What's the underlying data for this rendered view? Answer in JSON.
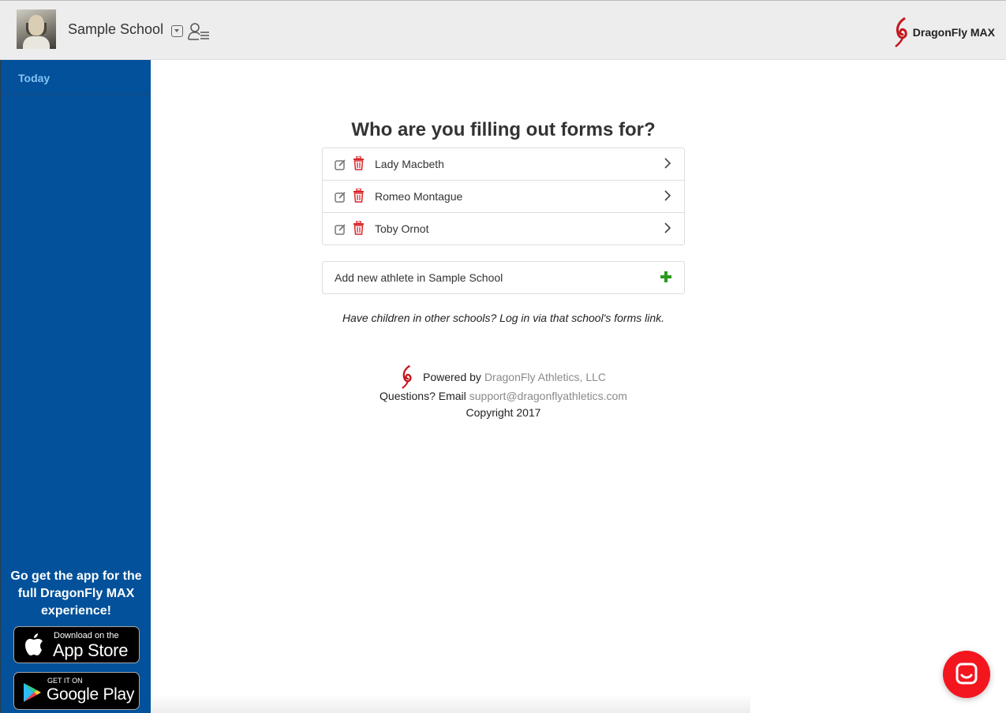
{
  "header": {
    "school_name": "Sample School",
    "brand_name": "DragonFly MAX",
    "brand_color": "#c4161c",
    "background": "#ededed"
  },
  "sidebar": {
    "background": "#02519a",
    "items": [
      {
        "label": "Today",
        "color": "#85c3f4"
      }
    ],
    "promo_text": "Go get the app for the full DragonFly MAX experience!",
    "app_store": {
      "small": "Download on the",
      "big": "App Store"
    },
    "google_play": {
      "small": "GET IT ON",
      "big": "Google Play"
    }
  },
  "main": {
    "title": "Who are you filling out forms for?",
    "athletes": [
      {
        "name": "Lady Macbeth"
      },
      {
        "name": "Romeo Montague"
      },
      {
        "name": "Toby Ornot"
      }
    ],
    "add_label": "Add new athlete in Sample School",
    "note": "Have children in other schools? Log in via that school's forms link."
  },
  "footer": {
    "powered_prefix": "Powered by",
    "powered_link": "DragonFly Athletics, LLC",
    "questions_prefix": "Questions? Email",
    "support_email": "support@dragonflyathletics.com",
    "copyright": "Copyright 2017"
  },
  "colors": {
    "trash": "#d9262a",
    "plus": "#2a9a1f",
    "chat": "#f3161f"
  }
}
